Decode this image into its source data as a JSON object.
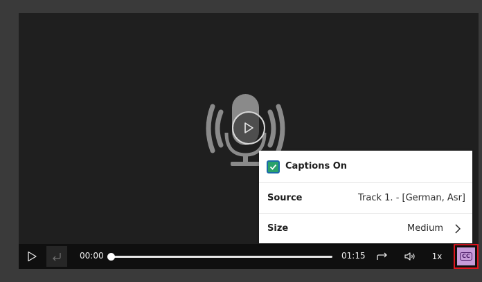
{
  "player": {
    "background_color": "#1f1f1f",
    "artwork_icon": "microphone-icon",
    "overlay_icon": "play-icon"
  },
  "controls": {
    "play_icon": "play-icon",
    "replay_icon": "return-arrow-icon",
    "current_time": "00:00",
    "duration": "01:15",
    "progress_fraction": 0.0,
    "forward_icon": "forward-arrow-icon",
    "volume_icon": "speaker-icon",
    "playback_speed": "1x",
    "captions_button_label": "CC",
    "captions_button_color": "#c79bd9",
    "highlight_color": "#e0141e"
  },
  "captions_menu": {
    "toggle_label": "Captions On",
    "toggle_checked": true,
    "source_label": "Source",
    "source_value": "Track 1. - [German, Asr]",
    "size_label": "Size",
    "size_value": "Medium"
  }
}
